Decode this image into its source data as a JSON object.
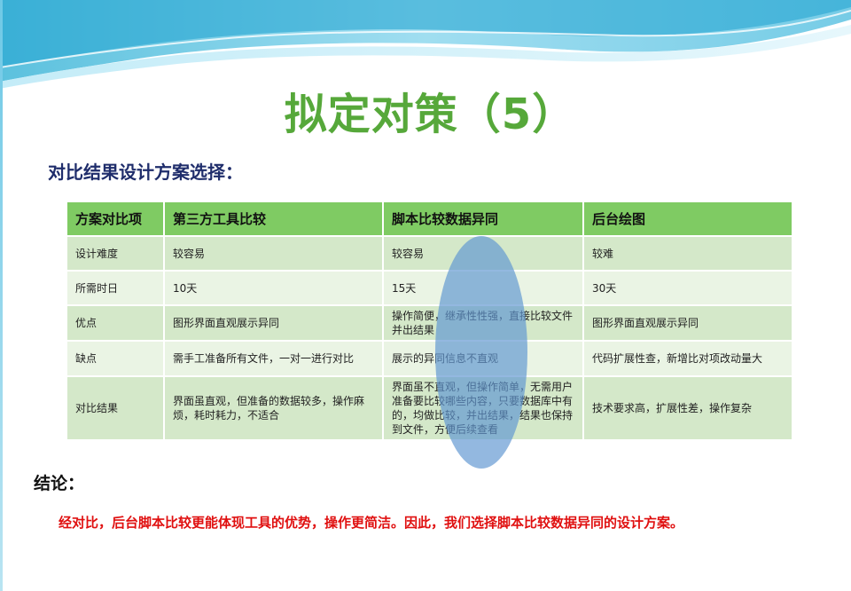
{
  "slide": {
    "title": "拟定对策（5）",
    "subtitle": "对比结果设计方案选择：",
    "table": {
      "headers": [
        "方案对比项",
        "第三方工具比较",
        "脚本比较数据异同",
        "后台绘图"
      ],
      "rows": [
        [
          "设计难度",
          "较容易",
          "较容易",
          "较难"
        ],
        [
          "所需时日",
          "10天",
          "15天",
          "30天"
        ],
        [
          "优点",
          "图形界面直观展示异同",
          "操作简便，继承性性强，直接比较文件并出结果",
          "图形界面直观展示异同"
        ],
        [
          "缺点",
          "需手工准备所有文件，一对一进行对比",
          "展示的异同信息不直观",
          "代码扩展性查，新增比对项改动量大"
        ],
        [
          "对比结果",
          "界面虽直观，但准备的数据较多，操作麻烦，耗时耗力，不适合",
          "界面虽不直观，但操作简单，无需用户准备要比较哪些内容，只要数据库中有的，均做比较，并出结果，结果也保持到文件，方便后续查看",
          "技术要求高，扩展性差，操作复杂"
        ]
      ]
    },
    "conclusion_heading": "结论：",
    "conclusion_text": "经对比，后台脚本比较更能体现工具的优势，操作更简洁。因此，我们选择脚本比较数据异同的设计方案。",
    "colors": {
      "title": "#56a83a",
      "subtitle": "#1f2d6b",
      "header_bg": "#7fcb63",
      "row_dark": "#d4e8c9",
      "row_light": "#eaf4e4",
      "highlight_oval": "#6096d2",
      "conclusion": "#e01010"
    }
  }
}
